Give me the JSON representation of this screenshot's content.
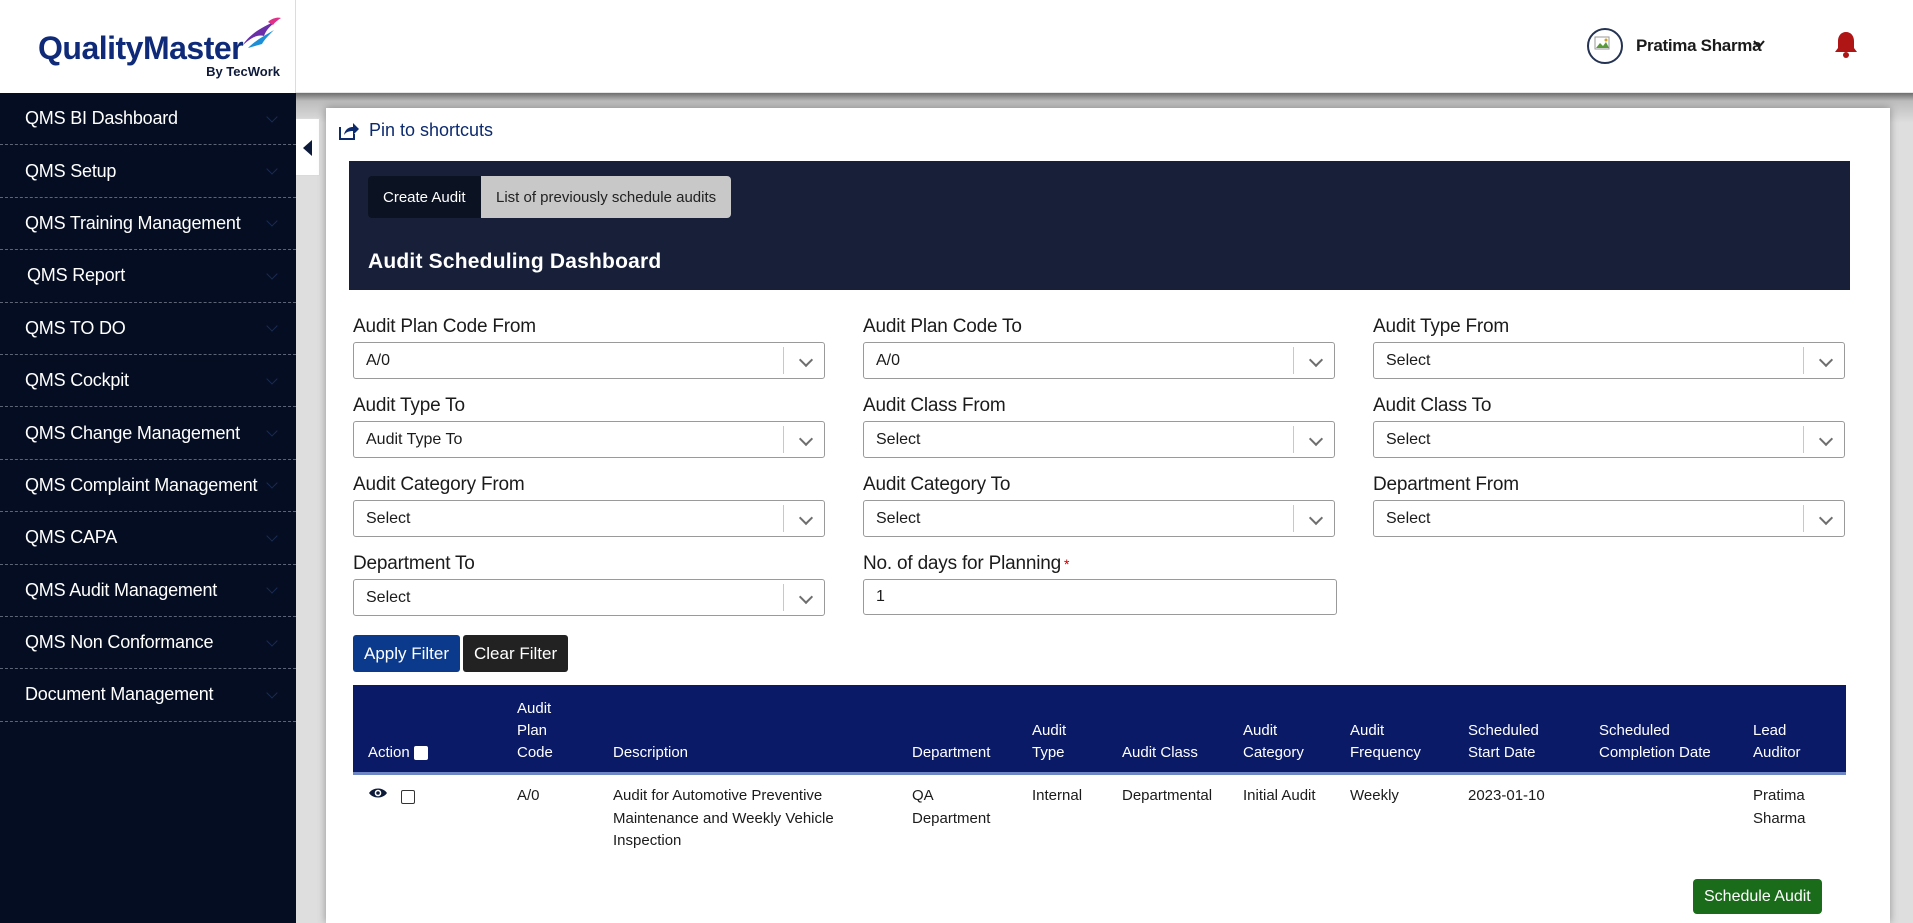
{
  "brand": {
    "name_part1": "Quality",
    "name_part2": "Master",
    "byline": "By TecWork"
  },
  "header": {
    "user_name": "Pratima Sharma"
  },
  "sidebar": {
    "items": [
      {
        "label": "QMS BI Dashboard"
      },
      {
        "label": "QMS Setup"
      },
      {
        "label": "QMS Training Management"
      },
      {
        "label": "QMS Report"
      },
      {
        "label": "QMS TO DO"
      },
      {
        "label": "QMS Cockpit"
      },
      {
        "label": "QMS Change Management"
      },
      {
        "label": "QMS Complaint Management"
      },
      {
        "label": "QMS CAPA"
      },
      {
        "label": "QMS Audit Management"
      },
      {
        "label": "QMS Non Conformance"
      },
      {
        "label": "Document Management"
      }
    ]
  },
  "pin_label": "Pin to shortcuts",
  "tabs": {
    "create": "Create Audit",
    "list": "List of previously schedule audits"
  },
  "page_title": "Audit Scheduling Dashboard",
  "filters": {
    "plan_code_from": {
      "label": "Audit Plan Code From",
      "value": "A/0"
    },
    "plan_code_to": {
      "label": "Audit Plan Code To",
      "value": "A/0"
    },
    "type_from": {
      "label": "Audit Type From",
      "value": "Select"
    },
    "type_to": {
      "label": "Audit Type To",
      "value": "Audit Type To"
    },
    "class_from": {
      "label": "Audit Class From",
      "value": "Select"
    },
    "class_to": {
      "label": "Audit Class To",
      "value": "Select"
    },
    "category_from": {
      "label": "Audit Category From",
      "value": "Select"
    },
    "category_to": {
      "label": "Audit Category To",
      "value": "Select"
    },
    "department_from": {
      "label": "Department From",
      "value": "Select"
    },
    "department_to": {
      "label": "Department To",
      "value": "Select"
    },
    "planning_days": {
      "label": "No. of days for Planning",
      "required_mark": "*",
      "value": "1"
    }
  },
  "buttons": {
    "apply": "Apply Filter",
    "clear": "Clear Filter",
    "schedule": "Schedule Audit"
  },
  "table": {
    "headers": {
      "action": "Action",
      "plan_code_1": "Audit",
      "plan_code_2": "Plan",
      "plan_code_3": "Code",
      "description": "Description",
      "department": "Department",
      "type_1": "Audit",
      "type_2": "Type",
      "class": "Audit Class",
      "category_1": "Audit",
      "category_2": "Category",
      "frequency_1": "Audit",
      "frequency_2": "Frequency",
      "start_1": "Scheduled",
      "start_2": "Start Date",
      "completion_1": "Scheduled",
      "completion_2": "Completion Date",
      "auditor_1": "Lead",
      "auditor_2": "Auditor"
    },
    "rows": [
      {
        "plan_code": "A/0",
        "description_1": "Audit for Automotive Preventive",
        "description_2": "Maintenance and Weekly Vehicle",
        "description_3": "Inspection",
        "department_1": "QA",
        "department_2": "Department",
        "type": "Internal",
        "class": "Departmental",
        "category": "Initial Audit",
        "frequency": "Weekly",
        "start_date": "2023-01-10",
        "completion_date": "",
        "auditor_1": "Pratima",
        "auditor_2": "Sharma"
      }
    ]
  },
  "colors": {
    "sidebar_bg": "#050d22",
    "hero_bg": "#172038",
    "table_header_bg": "#0a1a66",
    "apply_button": "#0b3a8c",
    "clear_button": "#222222",
    "schedule_button": "#1a6b1a",
    "bell": "#b01515",
    "brand_blue": "#0e2a78"
  },
  "icons": [
    "logo-bird-icon",
    "user-avatar-icon",
    "caret-down-icon",
    "bell-icon",
    "collapse-arrow-icon",
    "share-icon",
    "chevron-down-icon",
    "eye-icon",
    "checkbox-icon"
  ]
}
